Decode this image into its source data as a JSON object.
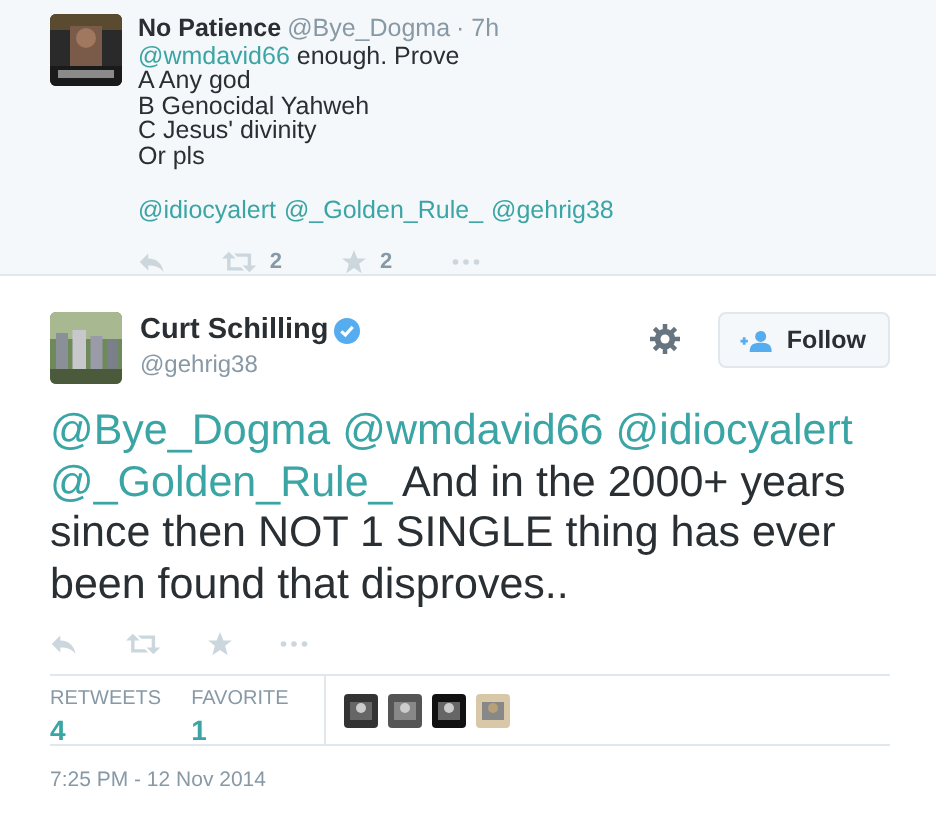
{
  "reply_tweet": {
    "name": "No Patience",
    "handle": "@Bye_Dogma",
    "time": "· 7h",
    "lines": [
      [
        {
          "kind": "mention",
          "text": "@wmdavid66"
        },
        {
          "kind": "plain",
          "text": " enough. Prove"
        }
      ],
      [
        {
          "kind": "plain",
          "text": "A Any god"
        }
      ],
      [
        {
          "kind": "plain",
          "text": "B Genocidal Yahweh"
        }
      ],
      [
        {
          "kind": "plain",
          "text": "C Jesus' divinity"
        }
      ],
      [
        {
          "kind": "plain",
          "text": "Or pls"
        }
      ]
    ],
    "mentions": [
      "@idiocyalert",
      "@_Golden_Rule_",
      "@gehrig38"
    ],
    "retweet_count": "2",
    "favorite_count": "2"
  },
  "main_tweet": {
    "name": "Curt Schilling",
    "verified": true,
    "handle": "@gehrig38",
    "follow_label": "Follow",
    "text": [
      {
        "kind": "mention",
        "text": "@Bye_Dogma"
      },
      {
        "kind": "mention",
        "text": "@wmdavid66"
      },
      {
        "kind": "mention",
        "text": "@idiocyalert"
      },
      {
        "kind": "mention",
        "text": "@_Golden_Rule_"
      },
      {
        "kind": "plain",
        "text": " And in the 2000+ years since then NOT 1 SINGLE thing has ever been found that disproves.."
      }
    ],
    "stats": [
      {
        "label": "RETWEETS",
        "value": "4"
      },
      {
        "label": "FAVORITE",
        "value": "1"
      }
    ],
    "date": "7:25 PM - 12 Nov 2014"
  }
}
